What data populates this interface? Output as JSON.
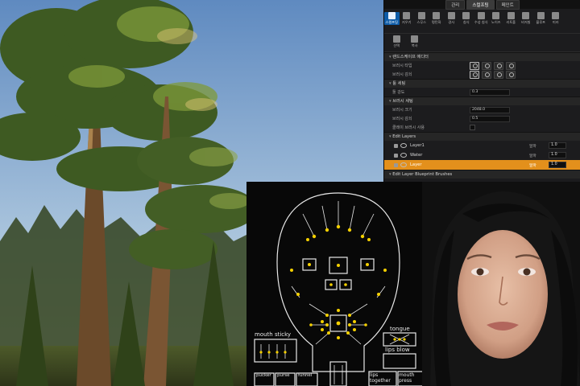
{
  "editor": {
    "mode_tabs": [
      "관리",
      "스컬프팅",
      "페인트"
    ],
    "active_mode": 1,
    "tools": [
      {
        "label": "스컬프팅",
        "icon": "sculpt-brush-icon",
        "active": true
      },
      {
        "label": "지우기",
        "icon": "eraser-icon"
      },
      {
        "label": "스무스",
        "icon": "smooth-icon"
      },
      {
        "label": "평탄화",
        "icon": "flatten-icon"
      },
      {
        "label": "경사",
        "icon": "ramp-icon"
      },
      {
        "label": "침식",
        "icon": "erosion-icon"
      },
      {
        "label": "수성 침식",
        "icon": "hydro-erosion-icon"
      },
      {
        "label": "노이즈",
        "icon": "noise-icon"
      },
      {
        "label": "리토폴",
        "icon": "retopo-icon"
      },
      {
        "label": "비저빌",
        "icon": "visibility-icon"
      },
      {
        "label": "블루프",
        "icon": "blueprint-icon"
      },
      {
        "label": "미러",
        "icon": "mirror-icon"
      }
    ],
    "tools_row2": [
      {
        "label": "선택",
        "icon": "select-icon"
      },
      {
        "label": "복사",
        "icon": "copy-icon"
      }
    ],
    "sections": {
      "landscape_editor": "랜드스케이프 에디터",
      "tool": "툴 세팅",
      "brush": "브러시 세팅",
      "edit_layers": "Edit Layers",
      "blueprint_brushes": "Edit Layer Blueprint Brushes"
    },
    "props": {
      "brush_type": "브러시 타입",
      "brush_falloff": "브러시 감쇠",
      "tool_strength": "툴 강도",
      "tool_strength_value": "0.3",
      "brush_size": "브러시 크기",
      "brush_size_value": "2048.0",
      "brush_falloff2": "브러시 감쇠",
      "brush_falloff_value": "0.5",
      "use_clay_brush": "클레이 브러시 사용"
    },
    "layers": [
      {
        "name": "Layer1",
        "alpha_label": "알파",
        "alpha": "1.0",
        "selected": false
      },
      {
        "name": "Water",
        "alpha_label": "알파",
        "alpha": "1.0",
        "selected": false
      },
      {
        "name": "Layer",
        "alpha_label": "알파",
        "alpha": "1.0",
        "selected": true
      }
    ]
  },
  "rig": {
    "labels": {
      "mouth_sticky": "mouth sticky",
      "tongue": "tongue",
      "lips_blow": "lips blow",
      "pucker": "pucker",
      "funnel": "funnel",
      "purse": "purse",
      "lips_together": "lips together",
      "mouth_press": "mouth press"
    },
    "line_color": "#e8e8e8",
    "control_color": "#f5d000"
  },
  "colors": {
    "selected_layer": "#e3901c",
    "active_tool": "#0e5ca8"
  }
}
